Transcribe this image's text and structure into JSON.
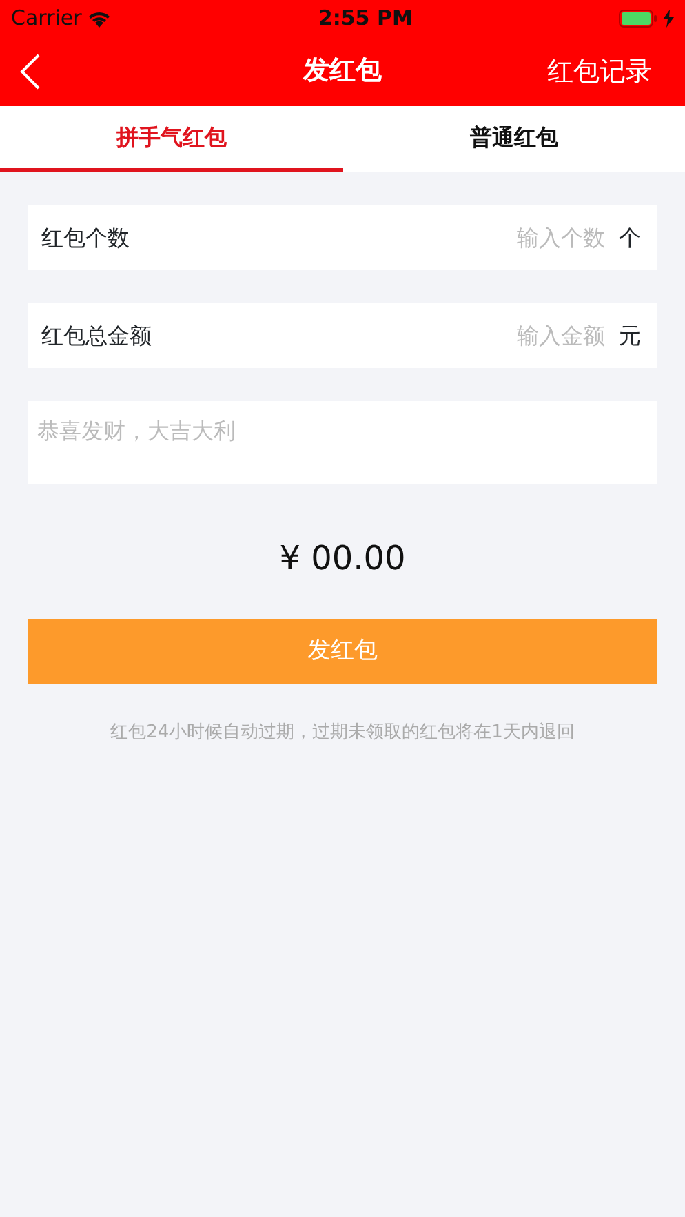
{
  "status_bar": {
    "carrier": "Carrier",
    "time": "2:55 PM"
  },
  "nav_bar": {
    "title": "发红包",
    "right_action": "红包记录"
  },
  "tabs": [
    {
      "label": "拼手气红包",
      "selected": true
    },
    {
      "label": "普通红包",
      "selected": false
    }
  ],
  "form": [
    {
      "kind": "input",
      "label": "红包个数",
      "placeholder": "输入个数",
      "unit": "个"
    },
    {
      "kind": "input",
      "label": "红包总金额",
      "placeholder": "输入金额",
      "unit": "元"
    },
    {
      "kind": "message",
      "placeholder": "恭喜发财，大吉大利"
    }
  ],
  "amount": "¥ 00.00",
  "submit_button": "发红包",
  "note": "红包24小时候自动过期，过期未领取的红包将在1天内退回"
}
